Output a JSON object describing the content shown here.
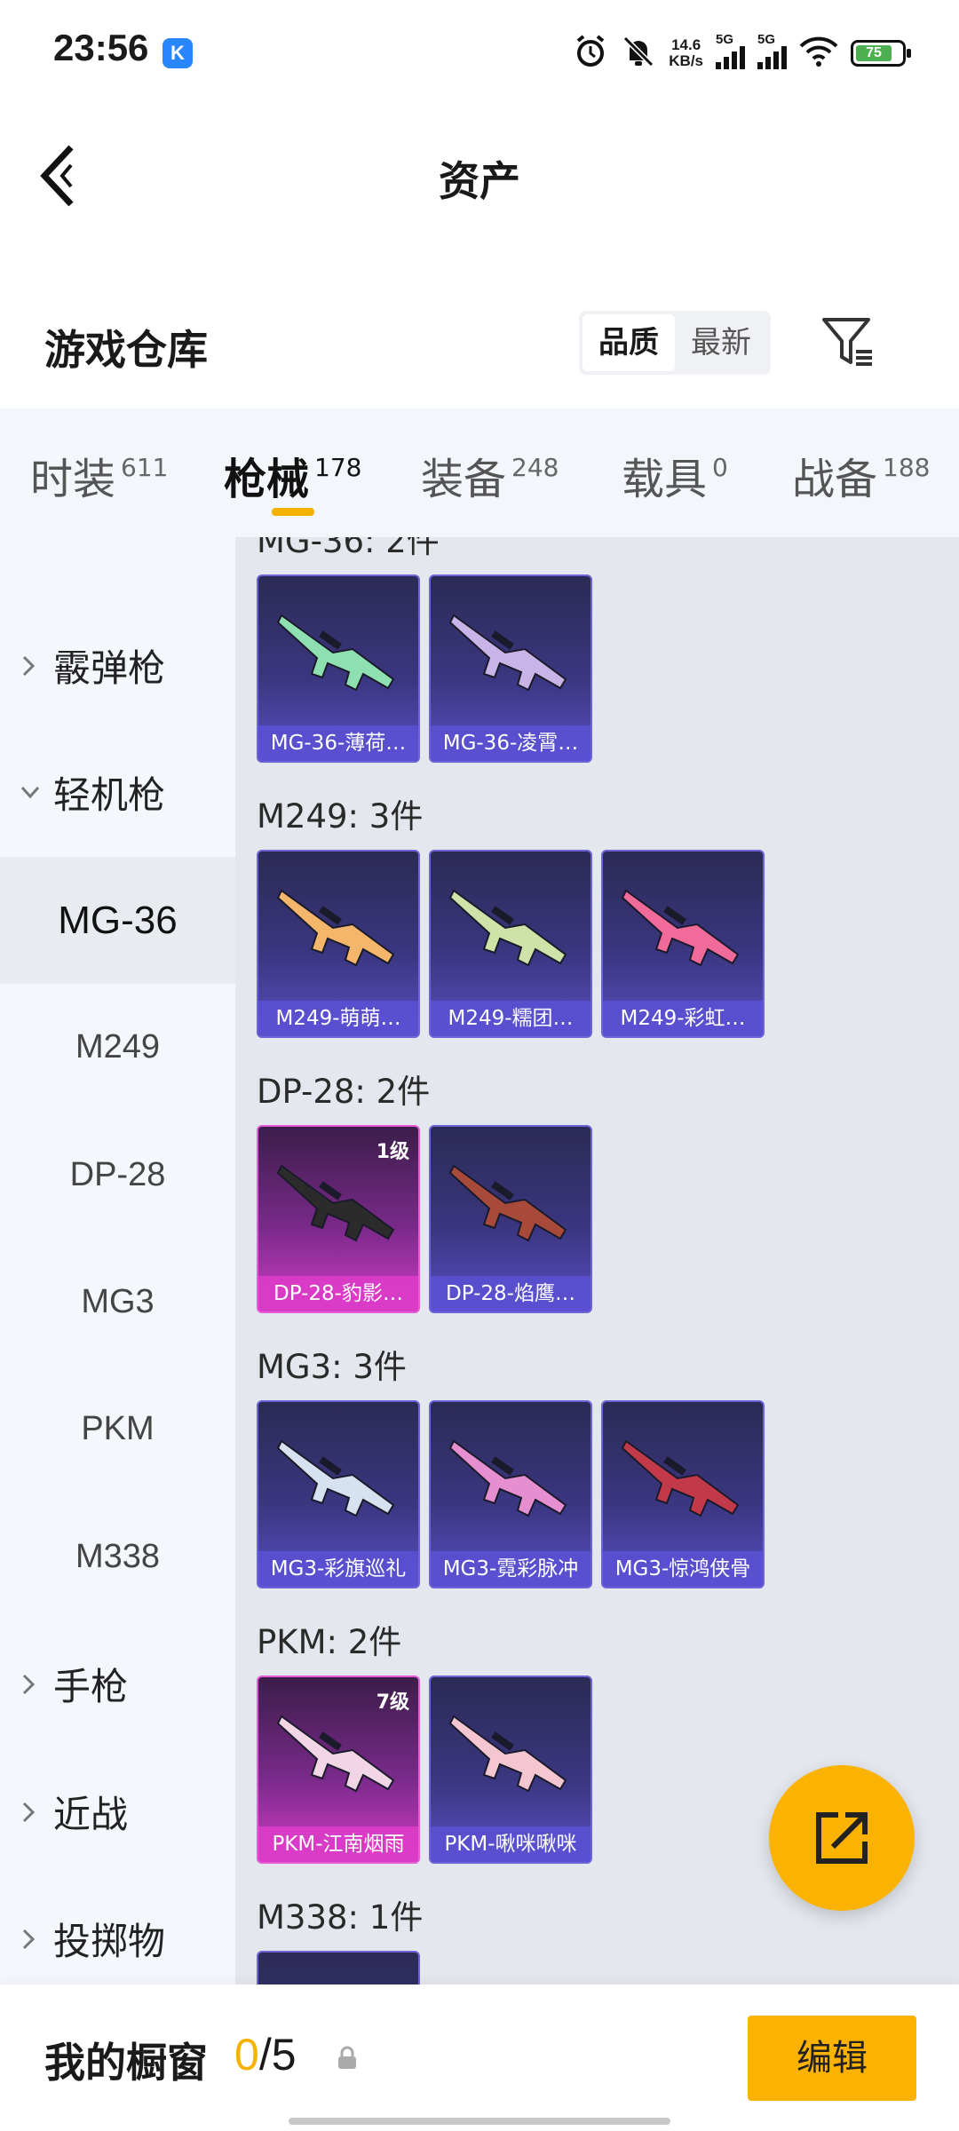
{
  "status_bar": {
    "time": "23:56",
    "app_badge": "K",
    "network_speed_top": "14.6",
    "network_speed_bottom": "KB/s",
    "signal1_label": "5G",
    "signal2_label": "5G",
    "battery_level": "75"
  },
  "header": {
    "title": "资产"
  },
  "warehouse": {
    "title": "游戏仓库",
    "sort_options": [
      "品质",
      "最新"
    ],
    "selected_sort": "品质"
  },
  "tabs": [
    {
      "label": "时装",
      "count": "611"
    },
    {
      "label": "枪械",
      "count": "178"
    },
    {
      "label": "装备",
      "count": "248"
    },
    {
      "label": "载具",
      "count": "0"
    },
    {
      "label": "战备",
      "count": "188"
    }
  ],
  "sidebar": {
    "items": [
      {
        "label": "霰弹枪",
        "type": "category"
      },
      {
        "label": "轻机枪",
        "type": "category_open"
      },
      {
        "label": "MG-36",
        "type": "sub_active"
      },
      {
        "label": "M249",
        "type": "sub"
      },
      {
        "label": "DP-28",
        "type": "sub"
      },
      {
        "label": "MG3",
        "type": "sub"
      },
      {
        "label": "PKM",
        "type": "sub"
      },
      {
        "label": "M338",
        "type": "sub"
      },
      {
        "label": "手枪",
        "type": "category"
      },
      {
        "label": "近战",
        "type": "category"
      },
      {
        "label": "投掷物",
        "type": "category"
      }
    ]
  },
  "groups": [
    {
      "label": "MG-36: 2件",
      "items": [
        {
          "name": "MG-36-薄荷…",
          "rarity": "purple",
          "level": "",
          "color": "#8fe0b0"
        },
        {
          "name": "MG-36-凌霄…",
          "rarity": "purple",
          "level": "",
          "color": "#c9b4e8"
        }
      ]
    },
    {
      "label": "M249: 3件",
      "items": [
        {
          "name": "M249-萌萌…",
          "rarity": "purple",
          "level": "",
          "color": "#f4b66a"
        },
        {
          "name": "M249-糯团…",
          "rarity": "purple",
          "level": "",
          "color": "#cfe3a8"
        },
        {
          "name": "M249-彩虹…",
          "rarity": "purple",
          "level": "",
          "color": "#f06a9a"
        }
      ]
    },
    {
      "label": "DP-28: 2件",
      "items": [
        {
          "name": "DP-28-豹影…",
          "rarity": "pink",
          "level": "1级",
          "color": "#2b2b2b"
        },
        {
          "name": "DP-28-焰鹰…",
          "rarity": "purple",
          "level": "",
          "color": "#a84a3a"
        }
      ]
    },
    {
      "label": "MG3: 3件",
      "items": [
        {
          "name": "MG3-彩旗巡礼",
          "rarity": "purple",
          "level": "",
          "color": "#d6e2f0"
        },
        {
          "name": "MG3-霓彩脉冲",
          "rarity": "purple",
          "level": "",
          "color": "#e58fd0"
        },
        {
          "name": "MG3-惊鸿侠骨",
          "rarity": "purple",
          "level": "",
          "color": "#c23a4a"
        }
      ]
    },
    {
      "label": "PKM: 2件",
      "items": [
        {
          "name": "PKM-江南烟雨",
          "rarity": "pink",
          "level": "7级",
          "color": "#f2d6e6"
        },
        {
          "name": "PKM-啾咪啾咪",
          "rarity": "purple",
          "level": "",
          "color": "#f4c6d2"
        }
      ]
    },
    {
      "label": "M338: 1件",
      "items": [
        {
          "name": "",
          "rarity": "purple",
          "level": "",
          "color": "#cccccc"
        }
      ]
    }
  ],
  "bottom_bar": {
    "title": "我的橱窗",
    "current": "0",
    "total": "/5",
    "edit_label": "编辑"
  },
  "colors": {
    "accent": "#fbb200",
    "purple_card": "#5a4fc4",
    "pink_card": "#d23cc5"
  },
  "icons": {
    "back": "chevron-left-icon",
    "filter": "filter-icon",
    "fab": "share-external-icon",
    "lock": "lock-icon"
  }
}
